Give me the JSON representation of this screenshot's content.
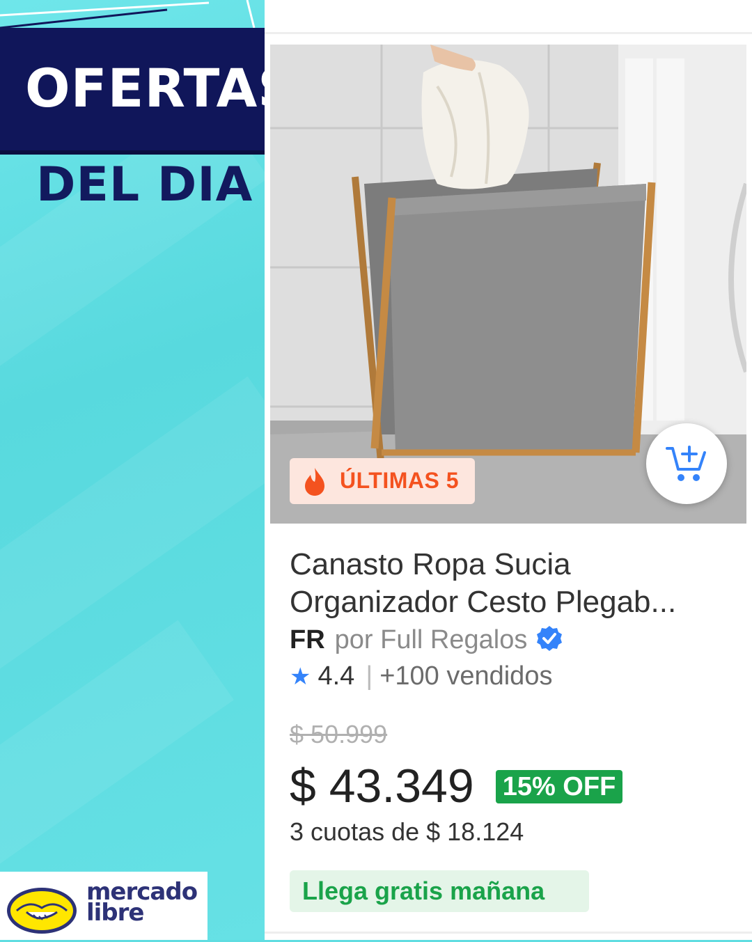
{
  "banner": {
    "title": "OFERTAS",
    "subtitle": "DEL DIA"
  },
  "brand": {
    "logo_icon": "handshake-icon",
    "line1": "mercado",
    "line2": "libre",
    "color": "#2d3277",
    "logo_yellow": "#ffe600"
  },
  "product": {
    "stock_badge": "ÚLTIMAS 5",
    "title_line1": "Canasto Ropa Sucia",
    "title_line2": "Organizador Cesto Plegab...",
    "seller_tag": "FR",
    "seller": "por Full Regalos",
    "rating": "4.4",
    "rating_sep": "|",
    "sold": "+100 vendidos",
    "old_price": "$ 50.999",
    "price": "$ 43.349",
    "discount": "15% OFF",
    "installments": "3 cuotas de $ 18.124",
    "shipping": "Llega gratis mañana"
  },
  "colors": {
    "accent_blue": "#3483fa",
    "discount_green": "#1aa34a",
    "stock_orange": "#f4521f",
    "banner_navy": "#10165a",
    "background_turquoise": "#5fdde1"
  }
}
